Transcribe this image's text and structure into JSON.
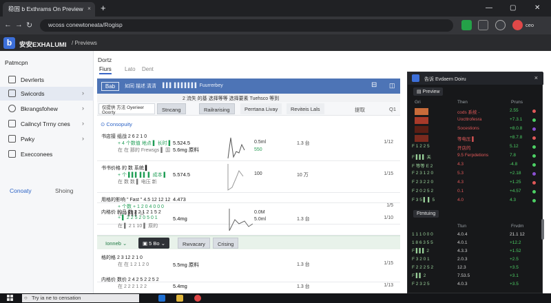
{
  "browser": {
    "tab_title": "稳固 b Exthrams On Preview",
    "tab_close": "×",
    "newtab": "+",
    "url": "wcoss conewtoneata/Rogisp",
    "win_min": "—",
    "win_max": "▢",
    "win_close": "✕"
  },
  "app": {
    "brand": "安安EXHALUMI",
    "breadcrumb": "/ Previews",
    "header_right": "ceo"
  },
  "sidebar": {
    "header": "Patmcpn",
    "items": [
      {
        "label": "Devrlerts"
      },
      {
        "label": "Swicords"
      },
      {
        "label": "Bkrangsfohew"
      },
      {
        "label": "Cailncyl Trrny cnes"
      },
      {
        "label": "Pwky"
      },
      {
        "label": "Execconees"
      }
    ],
    "foot_a": "Conoaty",
    "foot_b": "Shoing"
  },
  "main": {
    "title": "Dortz",
    "tabs": [
      "Fiurs",
      "Lato",
      "Dent"
    ],
    "banner_left": "Bab",
    "banner_text": "如同 描述 清清",
    "banner_mid": "▌▌▌ ▌▌▌▌▌▌▌ Fuurrerbey",
    "banner_head": "2 流失 的基 选择等等 选择要素 Tuehsco 等到",
    "filter": {
      "chip": "仅提供 方法 Oyerieer Goorty",
      "b1": "Stncang",
      "b2": "Railrarising",
      "b3": "Perrtana Livay",
      "b4": "Reviteis Lals",
      "b5": "提取",
      "b6": "Q1"
    },
    "group_label": "Consopuity",
    "rows": [
      {
        "lbl": "书店接 组战 2 6 2 1 0",
        "s1": "+ 4 个数值 地点 ▌ 长时 ▌",
        "s2": "在 在 那的 Frewsgs ▌ 国",
        "val": "5.524.5",
        "val2": "5.6mg 原料",
        "fig": "0.5ml",
        "fig2": "550",
        "num": "1.3 台",
        "fr": "1/12"
      },
      {
        "lbl": "书书价格 的 数 系统 ▌",
        "s1": "+ 个 ▌▌▌ ▌▌ ▌ 成本 ▌",
        "s2": "在 数 数 ▌ 电压 新",
        "val": "5.574.5",
        "val2": "",
        "fig": "100",
        "fig2": "",
        "num": "10 万",
        "fr": "1/15"
      },
      {
        "lbl": "用格的影响 \" Fast \" 4.5 12 12 12",
        "s1": "+ 个数 + 1 2 0 4 0 0 0",
        "s2": "在 1 ▌▌▌ 公",
        "val": "4.473",
        "val2": "",
        "fig": "",
        "fig2": "",
        "num": "",
        "fr": "1/5"
      },
      {
        "lbl": "内格价 的品 数 2 2 1 2 1 5 2",
        "s1": "+ ▌ 2 2 5 2 0 5 0 1",
        "s2": "在 ▌ 2 1 10 ▌ 原的",
        "val": "5.4mg",
        "val2": "",
        "fig": "0.0M",
        "fig2": "5.0ml",
        "num": "1.3 台",
        "fr": "1/10"
      }
    ],
    "green": {
      "g1": "Ionneb",
      "g2": "5 Bo",
      "g3": "Rwvacary",
      "g4": "Crising"
    },
    "rows2": [
      {
        "lbl": "格的格 2 3 12 2 1 0",
        "s1": "",
        "s2": "在 在 1 2 1 2 0",
        "val": "5.5mg 原料",
        "val2": "",
        "fig": "",
        "fig2": "",
        "num": "1.3 台",
        "fr": "1/15"
      },
      {
        "lbl": "内格价 数价 2 4 2 5 2 2 5 2",
        "s1": "",
        "s2": "在 2 2 2 1 2 2",
        "val": "5.4mg",
        "val2": "",
        "fig": "",
        "fig2": "",
        "num": "1.3 台",
        "fr": "1/13"
      }
    ]
  },
  "panel": {
    "title": "告诉 Evdaern Doiru",
    "close": "×",
    "sec1": "▤ Preview",
    "cols1": [
      "Gri",
      "Then",
      "Pruns"
    ],
    "rows1": [
      {
        "c1": "",
        "c2": "cods 系统 -",
        "c3": "2.55",
        "dot": "#e05858"
      },
      {
        "c1": "",
        "c2": "Uocttrofesra",
        "c3": "+7.3.1",
        "dot": "#4cd064"
      },
      {
        "c1": "",
        "c2": "Socestions",
        "c3": "+8.0.8",
        "dot": "#8a4fd0"
      },
      {
        "c1": "",
        "c2": "等电压 ▌",
        "c3": "+8.7.8",
        "dot": "#e05858"
      },
      {
        "c1": "F 1 2 2 5",
        "c2": "开店的",
        "c3": "5.12",
        "dot": "#4cd064"
      },
      {
        "c1": "F ▌▌▌ 关",
        "c2": "9.5 Ferpdetions",
        "c3": "7.8",
        "dot": "#4cd064"
      },
      {
        "c1": "F 等等 E 2",
        "c2": "4.3",
        "c3": "-4.8",
        "dot": "#4cd064"
      },
      {
        "c1": "F 2 3 1 2 0",
        "c2": "5.3",
        "c3": "+2.18",
        "dot": "#8a4fd0"
      },
      {
        "c1": "F 2 3 2 2 0",
        "c2": "4.3",
        "c3": "+1.25",
        "dot": "#e05858"
      },
      {
        "c1": "F 2 0 2 5 2",
        "c2": "0.1",
        "c3": "+4.57",
        "dot": "#4cd064"
      },
      {
        "c1": "F 3 5 ▌ ▌ 5",
        "c2": "4.0",
        "c3": "4.3",
        "dot": "#4cd064"
      }
    ],
    "sec2": "Ftmtuing",
    "cols2": [
      "Ttun",
      "Frvdm"
    ],
    "rows2": [
      {
        "c1": "1 1 1 0 0 0",
        "c2": "4.0.4",
        "c3": "21.1 12"
      },
      {
        "c1": "1 8 6 3 5 5",
        "c2": "4.0.1",
        "c3": "+12.2"
      },
      {
        "c1": "F ▌▌▌ 2",
        "c2": "4.3.3",
        "c3": "+1.52"
      },
      {
        "c1": "F 3 2 0 1",
        "c2": "2.0.3",
        "c3": "+2.5"
      },
      {
        "c1": "F 2 2 2 5 2",
        "c2": "12.3",
        "c3": "+3.5"
      },
      {
        "c1": "F ▌▌ 2",
        "c2": "7.53.5",
        "c3": "+3.1"
      },
      {
        "c1": "F 2 3 2 5",
        "c2": "4.0.3",
        "c3": "+3.5"
      },
      {
        "c1": "F ▌▌▌ 2 1",
        "c2": "1.3",
        "c3": "+2.8"
      },
      {
        "c1": "F ▌▌▌ 1 2",
        "c2": "6.2",
        "c3": "+1.3"
      },
      {
        "c1": "F 2 2 1 2",
        "c2": "4.2",
        "c3": "+1.5"
      }
    ]
  },
  "taskbar": {
    "search": "Try ia ne to censation"
  }
}
